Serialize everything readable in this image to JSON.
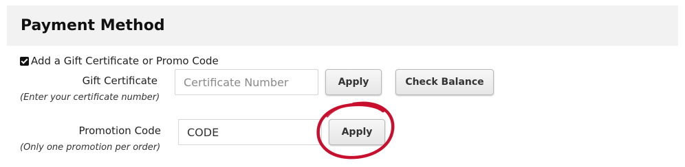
{
  "section": {
    "title": "Payment Method"
  },
  "gift_toggle": {
    "label": "Add a Gift Certificate or Promo Code",
    "checked": true
  },
  "gift_certificate": {
    "label": "Gift Certificate",
    "hint": "(Enter your certificate number)",
    "placeholder": "Certificate Number",
    "apply_label": "Apply",
    "check_balance_label": "Check Balance"
  },
  "promotion": {
    "label": "Promotion Code",
    "hint": "(Only one promotion per order)",
    "value": "CODE",
    "apply_label": "Apply"
  },
  "colors": {
    "header_background": "#f2f2f2",
    "annotation": "#c8102e"
  }
}
